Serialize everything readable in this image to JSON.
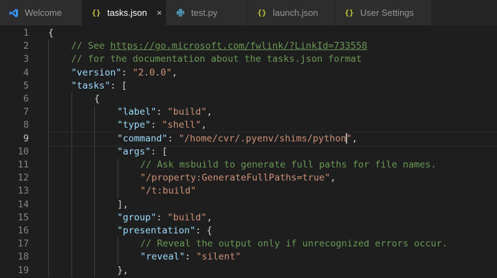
{
  "tabs": [
    {
      "label": "Welcome",
      "icon": "vscode-logo-icon",
      "active": false
    },
    {
      "label": "tasks.json",
      "icon": "json-braces-icon",
      "active": true,
      "close": "×"
    },
    {
      "label": "test.py",
      "icon": "python-icon",
      "active": false
    },
    {
      "label": "launch.json",
      "icon": "json-braces-icon",
      "active": false
    },
    {
      "label": "User Settings",
      "icon": "json-braces-icon",
      "active": false
    }
  ],
  "json_icon_glyph": "{}",
  "colors": {
    "comment": "#6a9955",
    "key": "#9cdcfe",
    "string": "#ce9178",
    "punctuation": "#d4d4d4",
    "line_number": "#858585",
    "json_icon": "#cbcb41",
    "python_icon": "#519aba",
    "vscode_icon": "#3794ff"
  },
  "editor": {
    "cursor_line": 9,
    "lines": [
      {
        "n": "1",
        "indent": 0,
        "tokens": [
          {
            "t": "{",
            "c": "p"
          }
        ]
      },
      {
        "n": "2",
        "indent": 1,
        "tokens": [
          {
            "t": "// See ",
            "c": "com"
          },
          {
            "t": "https://go.microsoft.com/fwlink/?LinkId=733558",
            "c": "com link"
          }
        ]
      },
      {
        "n": "3",
        "indent": 1,
        "tokens": [
          {
            "t": "// for the documentation about the tasks.json format",
            "c": "com"
          }
        ]
      },
      {
        "n": "4",
        "indent": 1,
        "tokens": [
          {
            "t": "\"version\"",
            "c": "key"
          },
          {
            "t": ": ",
            "c": "p"
          },
          {
            "t": "\"2.0.0\"",
            "c": "str"
          },
          {
            "t": ",",
            "c": "p"
          }
        ]
      },
      {
        "n": "5",
        "indent": 1,
        "tokens": [
          {
            "t": "\"tasks\"",
            "c": "key"
          },
          {
            "t": ": [",
            "c": "p"
          }
        ]
      },
      {
        "n": "6",
        "indent": 2,
        "tokens": [
          {
            "t": "{",
            "c": "p"
          }
        ]
      },
      {
        "n": "7",
        "indent": 3,
        "tokens": [
          {
            "t": "\"label\"",
            "c": "key"
          },
          {
            "t": ": ",
            "c": "p"
          },
          {
            "t": "\"build\"",
            "c": "str"
          },
          {
            "t": ",",
            "c": "p"
          }
        ]
      },
      {
        "n": "8",
        "indent": 3,
        "tokens": [
          {
            "t": "\"type\"",
            "c": "key"
          },
          {
            "t": ": ",
            "c": "p"
          },
          {
            "t": "\"shell\"",
            "c": "str"
          },
          {
            "t": ",",
            "c": "p"
          }
        ]
      },
      {
        "n": "9",
        "indent": 3,
        "tokens": [
          {
            "t": "\"command\"",
            "c": "key"
          },
          {
            "t": ": ",
            "c": "p"
          },
          {
            "t": "\"/home/cvr/.pyenv/shims/python",
            "c": "str"
          },
          {
            "t": "",
            "c": "caret"
          },
          {
            "t": "\"",
            "c": "str"
          },
          {
            "t": ",",
            "c": "p"
          }
        ]
      },
      {
        "n": "10",
        "indent": 3,
        "tokens": [
          {
            "t": "\"args\"",
            "c": "key"
          },
          {
            "t": ": [",
            "c": "p"
          }
        ]
      },
      {
        "n": "11",
        "indent": 4,
        "tokens": [
          {
            "t": "// Ask msbuild to generate full paths for file names.",
            "c": "com"
          }
        ]
      },
      {
        "n": "12",
        "indent": 4,
        "tokens": [
          {
            "t": "\"/property:GenerateFullPaths=true\"",
            "c": "str"
          },
          {
            "t": ",",
            "c": "p"
          }
        ]
      },
      {
        "n": "13",
        "indent": 4,
        "tokens": [
          {
            "t": "\"/t:build\"",
            "c": "str"
          }
        ]
      },
      {
        "n": "14",
        "indent": 3,
        "tokens": [
          {
            "t": "],",
            "c": "p"
          }
        ]
      },
      {
        "n": "15",
        "indent": 3,
        "tokens": [
          {
            "t": "\"group\"",
            "c": "key"
          },
          {
            "t": ": ",
            "c": "p"
          },
          {
            "t": "\"build\"",
            "c": "str"
          },
          {
            "t": ",",
            "c": "p"
          }
        ]
      },
      {
        "n": "16",
        "indent": 3,
        "tokens": [
          {
            "t": "\"presentation\"",
            "c": "key"
          },
          {
            "t": ": {",
            "c": "p"
          }
        ]
      },
      {
        "n": "17",
        "indent": 4,
        "tokens": [
          {
            "t": "// Reveal the output only if unrecognized errors occur.",
            "c": "com"
          }
        ]
      },
      {
        "n": "18",
        "indent": 4,
        "tokens": [
          {
            "t": "\"reveal\"",
            "c": "key"
          },
          {
            "t": ": ",
            "c": "p"
          },
          {
            "t": "\"silent\"",
            "c": "str"
          }
        ]
      },
      {
        "n": "19",
        "indent": 3,
        "tokens": [
          {
            "t": "},",
            "c": "p"
          }
        ]
      }
    ]
  }
}
